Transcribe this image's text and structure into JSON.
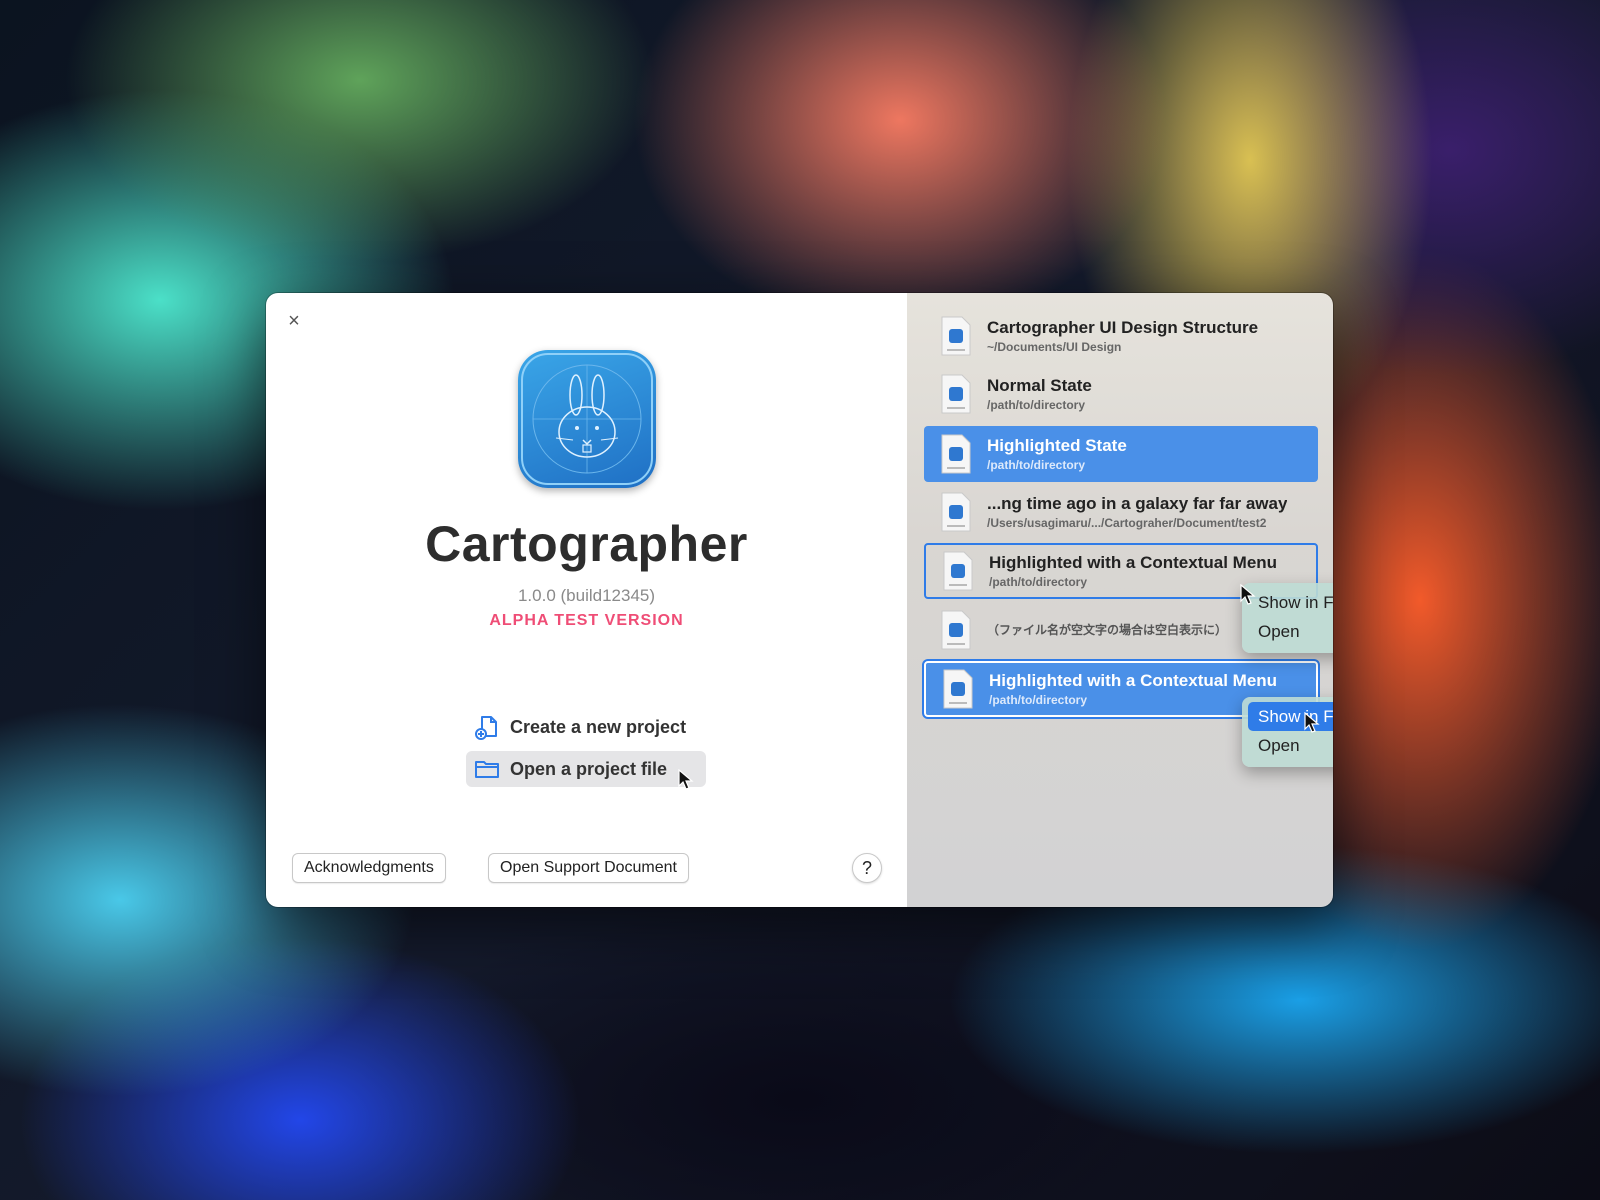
{
  "app": {
    "title": "Cartographer",
    "version": "1.0.0 (build12345)",
    "badge": "ALPHA TEST VERSION"
  },
  "actions": {
    "new_project": "Create a new project",
    "open_project": "Open a project file"
  },
  "footer": {
    "acknowledgments": "Acknowledgments",
    "support": "Open Support Document",
    "help": "?"
  },
  "window": {
    "close": "×"
  },
  "recent": [
    {
      "title": "Cartographer UI Design Structure",
      "path": "~/Documents/UI Design",
      "state": "normal"
    },
    {
      "title": "Normal State",
      "path": "/path/to/directory",
      "state": "normal"
    },
    {
      "title": "Highlighted State",
      "path": "/path/to/directory",
      "state": "selected"
    },
    {
      "title": "...ng time ago in a galaxy far far away",
      "path": "/Users/usagimaru/.../Cartograher/Document/test2",
      "state": "normal"
    },
    {
      "title": "Highlighted with a Contextual Menu",
      "path": "/path/to/directory",
      "state": "context"
    },
    {
      "title": "",
      "path": "（ファイル名が空文字の場合は空白表示に）",
      "state": "normal"
    },
    {
      "title": "Highlighted with a Contextual Menu",
      "path": "/path/to/directory",
      "state": "context-selected"
    }
  ],
  "context_menus": [
    {
      "items": [
        "Show in Finder",
        "Open"
      ],
      "active_index": -1
    },
    {
      "items": [
        "Show in Finder",
        "Open"
      ],
      "active_index": 0
    }
  ],
  "colors": {
    "accent": "#4a90e8",
    "alpha_badge": "#ef4d76",
    "selection": "#2f7ce8"
  }
}
